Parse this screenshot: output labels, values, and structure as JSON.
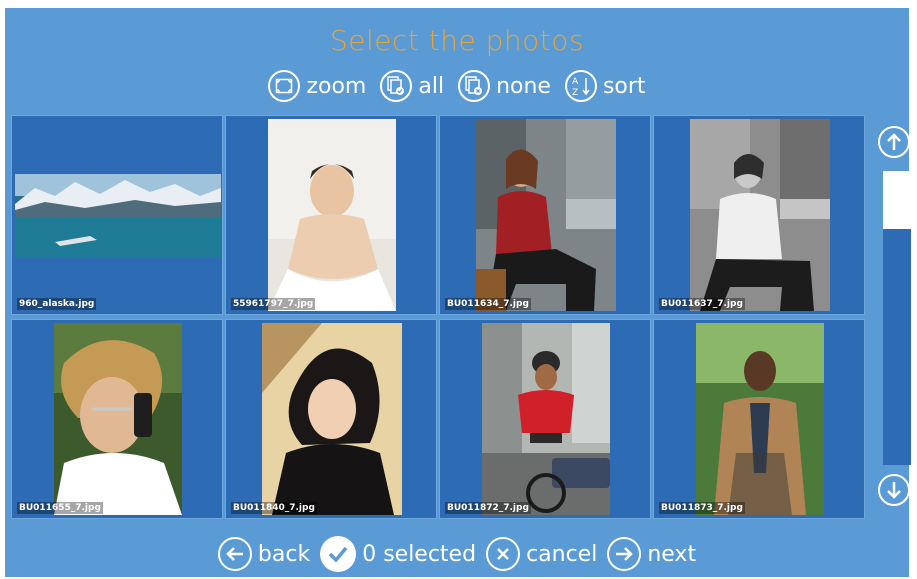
{
  "header": {
    "title": "Select the photos"
  },
  "toolbar": {
    "zoom_label": "zoom",
    "all_label": "all",
    "none_label": "none",
    "sort_label": "sort"
  },
  "photos": [
    {
      "filename": "960_alaska.jpg"
    },
    {
      "filename": "55961797_7.jpg"
    },
    {
      "filename": "BU011634_7.jpg"
    },
    {
      "filename": "BU011637_7.jpg"
    },
    {
      "filename": "BU011655_7.jpg"
    },
    {
      "filename": "BU011840_7.jpg"
    },
    {
      "filename": "BU011872_7.jpg"
    },
    {
      "filename": "BU011873_7.jpg"
    }
  ],
  "footer": {
    "back_label": "back",
    "selected_label": "0 selected",
    "cancel_label": "cancel",
    "next_label": "next"
  },
  "colors": {
    "background": "#5b9bd5",
    "tile": "#2d6cb5",
    "title": "#e8a33a"
  }
}
